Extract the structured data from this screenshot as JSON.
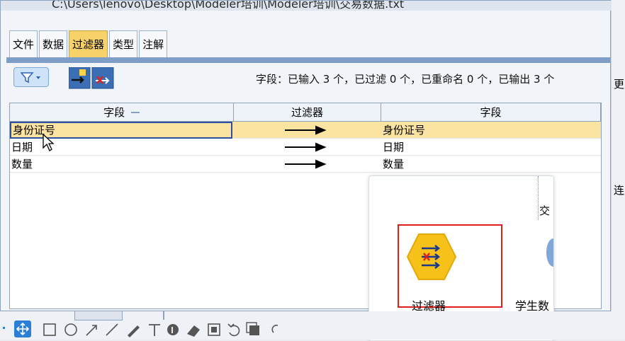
{
  "window": {
    "path": "C:\\Users\\lenovo\\Desktop\\Modeler培训\\Modeler培训\\交易数据.txt"
  },
  "tabs": [
    {
      "label": "文件",
      "active": false
    },
    {
      "label": "数据",
      "active": false
    },
    {
      "label": "过滤器",
      "active": true
    },
    {
      "label": "类型",
      "active": false
    },
    {
      "label": "注解",
      "active": false
    }
  ],
  "toolbar": {
    "summary": "字段：已输入 3 个，已过滤 0 个，已重命名 0 个，已输出 3 个"
  },
  "table": {
    "headers": [
      "字段",
      "过滤器",
      "字段"
    ],
    "rows": [
      {
        "input": "身份证号",
        "output": "身份证号",
        "selected": true
      },
      {
        "input": "日期",
        "output": "日期",
        "selected": false
      },
      {
        "input": "数量",
        "output": "数量",
        "selected": false
      }
    ]
  },
  "popup": {
    "top_label_partial": "交",
    "filter_node_label": "过滤器",
    "second_node_label": "学生数"
  },
  "side_text": {
    "right_a": "更",
    "right_b": "连"
  },
  "colors": {
    "accent_tab": "#f7d16a",
    "selected_row": "#fbe3a2",
    "highlight_box": "#e21d1d",
    "node_yellow": "#f6c21a"
  },
  "annotation_tools": [
    "move-icon",
    "rectangle-icon",
    "circle-icon",
    "arrow-icon",
    "line-icon",
    "pen-icon",
    "text-icon",
    "number-icon",
    "eraser-icon",
    "mosaic-icon",
    "undo-icon",
    "copy-icon",
    "link-icon"
  ]
}
